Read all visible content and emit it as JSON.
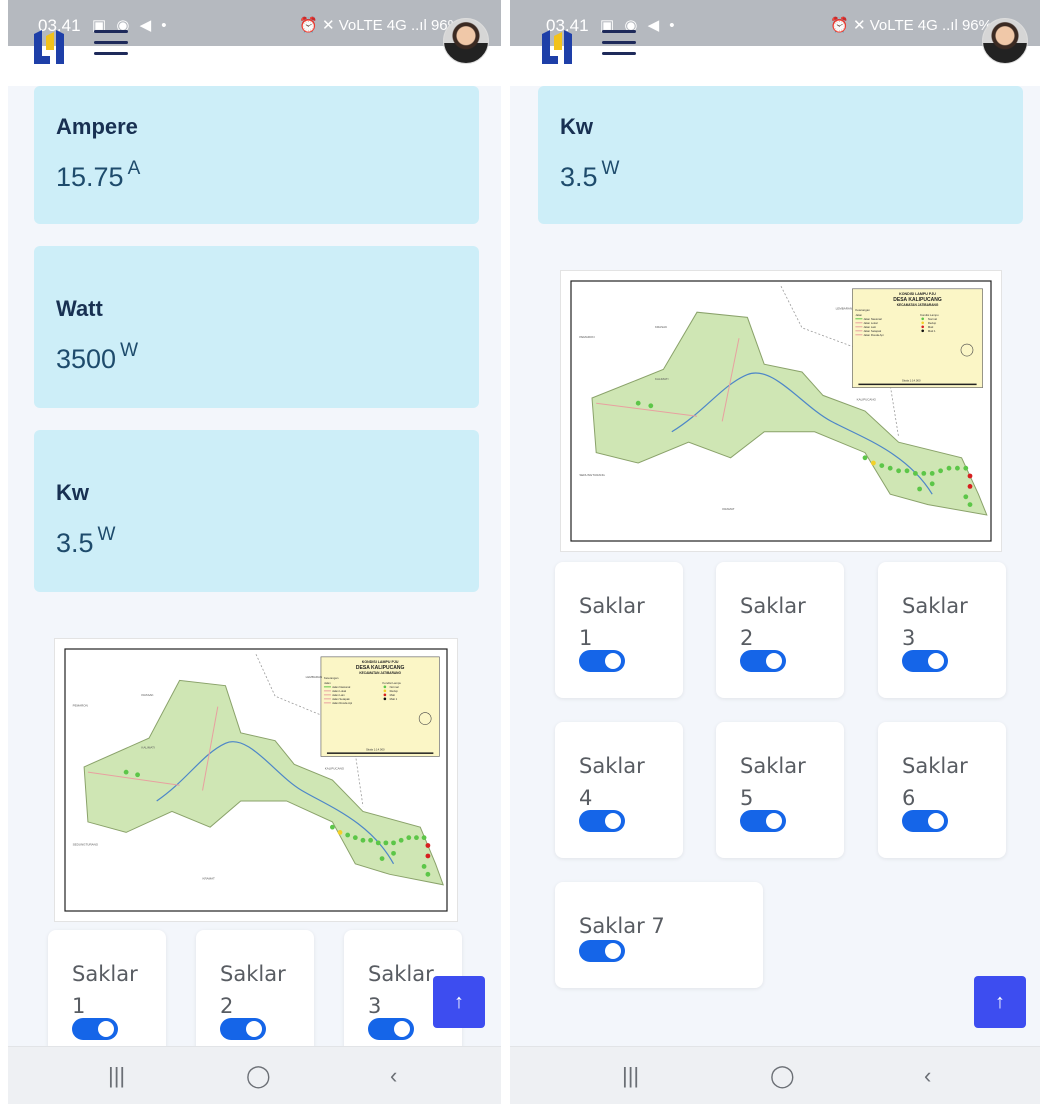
{
  "status_bar": {
    "time": "03.41",
    "notification_icons": "▣ ◉ ◀ •",
    "system_icons_left": "⏰ ✕ VoLTE 4G ..ıl 96%",
    "system_icons_right": "⏰ ✕ VoLTE 4G ..ıl 96%"
  },
  "left": {
    "cards": [
      {
        "title": "Ampere",
        "value": "15.75",
        "unit": "A"
      },
      {
        "title": "Watt",
        "value": "3500",
        "unit": "W"
      },
      {
        "title": "Kw",
        "value": "3.5",
        "unit": "W"
      }
    ],
    "switches": [
      {
        "label": "Saklar",
        "number": "1",
        "on": true
      },
      {
        "label": "Saklar",
        "number": "2",
        "on": true
      },
      {
        "label": "Saklar",
        "number": "3",
        "on": true
      }
    ]
  },
  "right": {
    "card": {
      "title": "Kw",
      "value": "3.5",
      "unit": "W"
    },
    "switches": [
      {
        "label": "Saklar",
        "number": "1",
        "on": true
      },
      {
        "label": "Saklar",
        "number": "2",
        "on": true
      },
      {
        "label": "Saklar",
        "number": "3",
        "on": true
      },
      {
        "label": "Saklar",
        "number": "4",
        "on": true
      },
      {
        "label": "Saklar",
        "number": "5",
        "on": true
      },
      {
        "label": "Saklar",
        "number": "6",
        "on": true
      },
      {
        "label": "Saklar 7",
        "number": "",
        "on": true
      }
    ]
  },
  "map": {
    "title_line1": "KONDISI LAMPU PJU",
    "title_line2": "DESA KALIPUCANG",
    "title_line3": "KECAMATAN JATIBARANG",
    "legend_heading": "Keterangan",
    "legend_col1": "Jalan",
    "legend_col2": "Kondisi Lampu",
    "roads": [
      "Jalan Nasional",
      "Jalan Lokal",
      "Jalan Lain",
      "Jalan Setapak",
      "Jalan Rosda Api"
    ],
    "lamps": [
      "Normal",
      "Redup",
      "Mati",
      "Mati 1"
    ],
    "scale": "Skala 1:14.000",
    "places": [
      "KRASAK",
      "PEMARON",
      "LEMBARAN",
      "KALIMATI",
      "KALIPUCANG",
      "KRAMAT",
      "SEDUNGTURANG"
    ],
    "colors": {
      "area": "#cfe6b4",
      "normal": "#5cc648",
      "redup": "#f2d12a",
      "mati": "#d62020",
      "mati1": "#111111",
      "river": "#4d86c8",
      "legend_bg": "#fbf6c6"
    }
  },
  "fab": {
    "icon": "arrow-up-icon",
    "glyph": "↑"
  },
  "navbar": {
    "recent": "|||",
    "home": "◯",
    "back": "‹"
  }
}
